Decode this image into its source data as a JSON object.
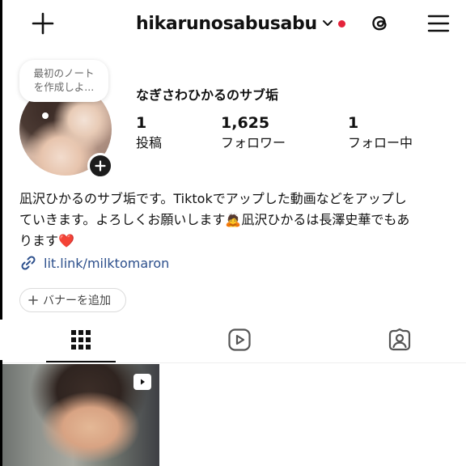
{
  "header": {
    "username": "hikarunosabusabu",
    "icons": [
      "plus-icon",
      "chevron-down-icon",
      "threads-icon",
      "hamburger-menu-icon"
    ],
    "notification_color": "#e4233b"
  },
  "profile": {
    "note_placeholder_line1": "最初のノート",
    "note_placeholder_line2": "を作成しよ...",
    "display_name": "なぎさわひかるのサブ垢",
    "stats": {
      "posts": {
        "value": "1",
        "label": "投稿"
      },
      "followers": {
        "value": "1,625",
        "label": "フォロワー"
      },
      "following": {
        "value": "1",
        "label": "フォロー中"
      }
    },
    "bio_line1": "凪沢ひかるのサブ垢です。Tiktokでアップした動画などをアップし",
    "bio_line2": "ていきます。よろしくお願いします",
    "bio_line2_emoji": "🙇",
    "bio_line2_tail": "凪沢ひかるは長澤史華でもあ",
    "bio_line3": "ります",
    "bio_line3_emoji": "❤️",
    "link": "lit.link/milktomaron",
    "banner_button": "バナーを追加"
  },
  "tabs": [
    {
      "name": "posts-grid",
      "icon": "grid-icon",
      "active": true
    },
    {
      "name": "reels",
      "icon": "reels-icon",
      "active": false
    },
    {
      "name": "tagged",
      "icon": "tagged-person-icon",
      "active": false
    }
  ],
  "colors": {
    "link": "#2c4f8c",
    "accent_red": "#e4233b"
  }
}
